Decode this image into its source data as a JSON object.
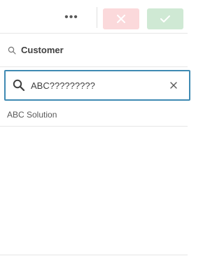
{
  "toolbar": {
    "more_label": "•••",
    "more_icon": "ellipsis-icon",
    "cancel_icon": "close-icon",
    "confirm_icon": "checkmark-icon",
    "cancel_color": "#fbd9db",
    "confirm_color": "#cfe9d4"
  },
  "field": {
    "title": "Customer",
    "title_icon": "search-icon"
  },
  "search": {
    "value": "ABC?????????",
    "icon": "search-icon",
    "clear_icon": "close-icon",
    "border_color": "#3f8ab3"
  },
  "results": [
    {
      "label": "ABC Solution"
    }
  ]
}
